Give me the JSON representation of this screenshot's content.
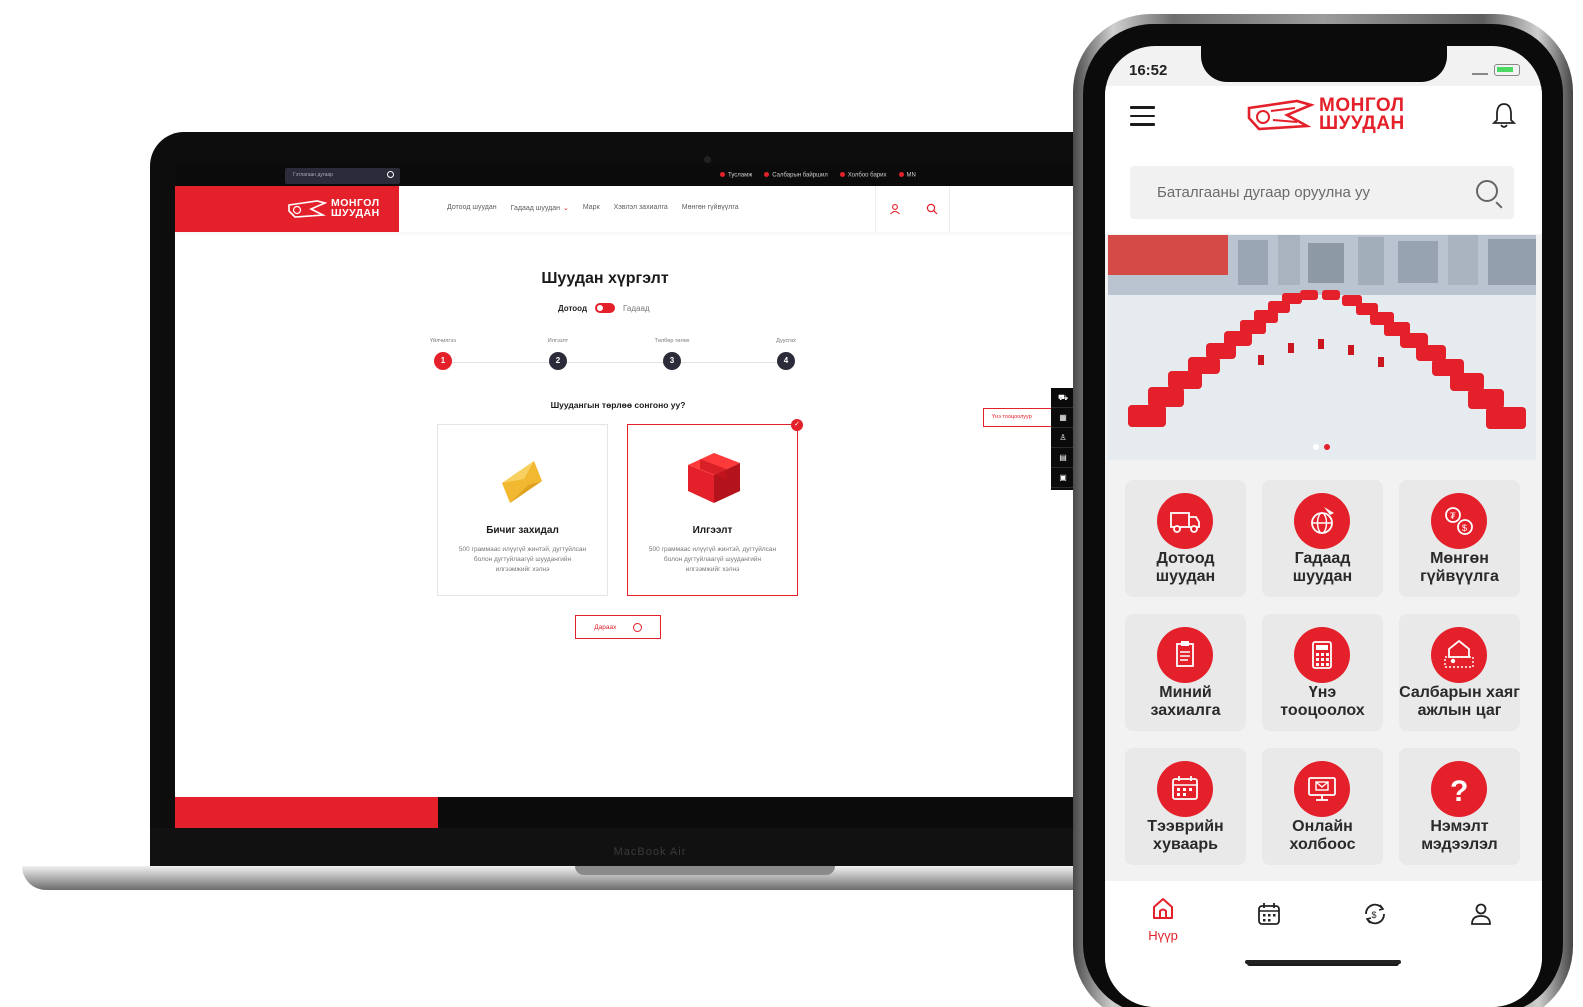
{
  "laptop": {
    "chin_label": "MacBook Air",
    "topbar": {
      "search_placeholder": "Гэтлагаан дугаар",
      "links": [
        "Тусламж",
        "Салбарын байршил",
        "Холбоо барих",
        "MN"
      ]
    },
    "nav": {
      "logo_line1": "МОНГОЛ",
      "logo_line2": "ШУУДАН",
      "links": [
        "Дотоод шуудан",
        "Гадаад шуудан",
        "Марк",
        "Хэвлэл захиалга",
        "Мөнгөн гүйвүүлга"
      ]
    },
    "page_title": "Шуудан хүргэлт",
    "toggle": {
      "left": "Дотоод",
      "right": "Гадаад"
    },
    "steps": [
      {
        "label": "Үйлчилгээ",
        "num": "1"
      },
      {
        "label": "Илгээлт",
        "num": "2"
      },
      {
        "label": "Төлбөр төлөх",
        "num": "3"
      },
      {
        "label": "Дуусгах",
        "num": "4"
      }
    ],
    "question": "Шуудангын төрлөө сонгоно уу?",
    "options": [
      {
        "title": "Бичиг захидал",
        "desc": "500 граммаас илүүгүй жинтэй, дугтуйлсан болон дугтуйлаагүй шуудангийн илгээмжийг хэлнэ"
      },
      {
        "title": "Илгээлт",
        "desc": "500 граммаас илүүгүй жинтэй, дугтуйлсан болон дугтуйлаагүй шуудангийн илгээмжийг хэлнэ"
      }
    ],
    "next_button": "Дараах",
    "price_tab": "Үнэ тооцоолуур"
  },
  "phone": {
    "status_time": "16:52",
    "logo_line1": "МОНГОЛ",
    "logo_line2": "ШУУДАН",
    "search_placeholder": "Баталгааны дугаар оруулна уу",
    "tiles": [
      {
        "l1": "Дотоод",
        "l2": "шуудан",
        "icon": "truck-icon"
      },
      {
        "l1": "Гадаад",
        "l2": "шуудан",
        "icon": "globe-plane-icon"
      },
      {
        "l1": "Мөнгөн",
        "l2": "гүйвүүлга",
        "icon": "money-transfer-icon"
      },
      {
        "l1": "Миний",
        "l2": "захиалга",
        "icon": "clipboard-icon"
      },
      {
        "l1": "Үнэ",
        "l2": "тооцоолох",
        "icon": "calculator-icon"
      },
      {
        "l1": "Салбарын хаяг",
        "l2": "ажлын цаг",
        "icon": "branch-location-icon"
      },
      {
        "l1": "Тээврийн",
        "l2": "хуваарь",
        "icon": "calendar-icon"
      },
      {
        "l1": "Онлайн",
        "l2": "холбоос",
        "icon": "online-mail-icon"
      },
      {
        "l1": "Нэмэлт",
        "l2": "мэдээлэл",
        "icon": "question-icon"
      }
    ],
    "bottom_nav": {
      "home": "Нүүр"
    }
  },
  "colors": {
    "brand_red": "#e4202a",
    "dark": "#0b0b0b"
  }
}
